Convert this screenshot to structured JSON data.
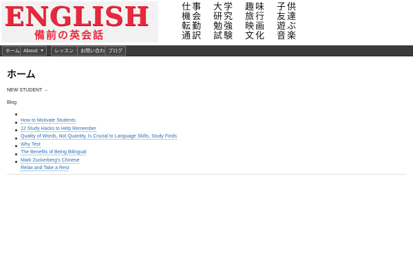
{
  "header": {
    "logo": {
      "title": "ENGLISH",
      "subtitle": "備前の英会話"
    },
    "kanji_columns": [
      [
        "仕事",
        "機会",
        "転勤",
        "通訳"
      ],
      [
        "大学",
        "研究",
        "勉強",
        "試験"
      ],
      [
        "趣味",
        "旅行",
        "映画",
        "文化"
      ],
      [
        "子供",
        "友達",
        "遊ぶ",
        "音楽"
      ]
    ]
  },
  "nav": {
    "items": [
      {
        "label": "ホーム",
        "has_dropdown": false
      },
      {
        "label": "About",
        "has_dropdown": true
      },
      {
        "label": "レッスン",
        "has_dropdown": true
      },
      {
        "label": "お問い合わせ",
        "has_dropdown": false
      },
      {
        "label": "ブログ",
        "has_dropdown": false
      }
    ]
  },
  "main": {
    "title": "ホーム",
    "new_student_link": "NEW STUDENT →",
    "blog_label": "Blog",
    "posts": [
      "How to Motivate Students",
      "12 Study Hacks to Help Remember",
      "Quality of Words, Not Quantity, Is Crucial to Language Skills, Study Finds",
      "Why Test",
      "The Benefits of Being Bilingual",
      "Mark Zuckerberg's Chinese",
      "Relax and Take a Rest"
    ]
  },
  "colors": {
    "logo_red": "#e8283c",
    "nav_bg": "#3a3a3a",
    "link_blue": "#2a6fb5"
  }
}
